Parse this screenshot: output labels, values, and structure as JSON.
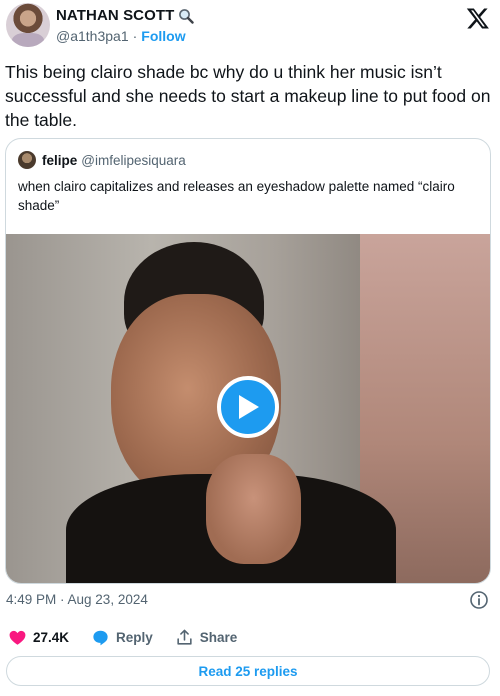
{
  "author": {
    "display_name": "NATHAN SCOTT",
    "badge_icon": "magnifying-glass-icon",
    "handle": "@a1th3pa1",
    "separator": "·",
    "follow_label": "Follow"
  },
  "tweet": {
    "text": "This being clairo shade bc why do u think her music isn’t successful and she needs to start a makeup line to put food on the table."
  },
  "quote": {
    "display_name": "felipe",
    "handle": "@imfelipesiquara",
    "text": "when clairo capitalizes and releases an eyeshadow palette named “clairo shade”",
    "media": {
      "type": "video",
      "play_icon": "play-icon"
    }
  },
  "meta": {
    "timestamp": "4:49 PM · Aug 23, 2024"
  },
  "actions": {
    "likes_count": "27.4K",
    "reply_label": "Reply",
    "share_label": "Share"
  },
  "read_replies_label": "Read 25 replies",
  "colors": {
    "accent": "#1d9bf0",
    "like": "#f91880",
    "text": "#0f1419",
    "muted": "#536471",
    "border": "#cfd9de"
  }
}
